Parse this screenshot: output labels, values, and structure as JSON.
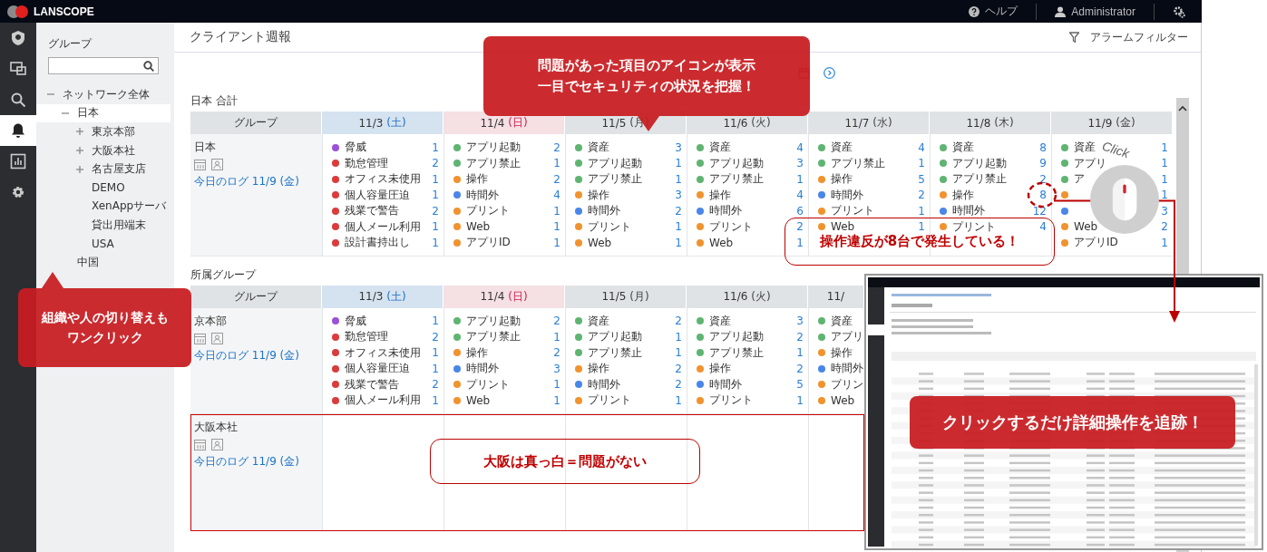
{
  "top_bar": {
    "logo": "LANSCOPE",
    "help": "ヘルプ",
    "user": "Administrator"
  },
  "nav_icons": [
    {
      "kind": "shield",
      "selected": false
    },
    {
      "kind": "monitor",
      "selected": false
    },
    {
      "kind": "search",
      "selected": false
    },
    {
      "kind": "bell",
      "selected": true
    },
    {
      "kind": "chart",
      "selected": false
    },
    {
      "kind": "gear",
      "selected": false
    }
  ],
  "group_panel": {
    "title": "グループ",
    "tree": [
      {
        "label": "ネットワーク全体",
        "expanded": true,
        "selected": false,
        "children": [
          {
            "label": "日本",
            "expanded": true,
            "selected": true,
            "children": [
              {
                "label": "東京本部",
                "expanded": false,
                "selected": false
              },
              {
                "label": "大阪本社",
                "expanded": false,
                "selected": false
              },
              {
                "label": "名古屋支店",
                "expanded": false,
                "selected": false
              },
              {
                "label": "DEMO",
                "selected": false
              },
              {
                "label": "XenAppサーバ",
                "selected": false
              },
              {
                "label": "貸出用端末",
                "selected": false
              },
              {
                "label": "USA",
                "selected": false
              }
            ]
          },
          {
            "label": "中国",
            "selected": false
          }
        ]
      }
    ]
  },
  "page": {
    "title": "クライアント週報",
    "filter": "アラームフィルター"
  },
  "sections": [
    {
      "title": "日本 合計",
      "group_header": "グループ",
      "days": [
        {
          "date": "11/3",
          "weekday": "(土)",
          "kind": "saturday"
        },
        {
          "date": "11/4",
          "weekday": "(日)",
          "kind": "sunday"
        },
        {
          "date": "11/5",
          "weekday": "(月)",
          "kind": "weekday"
        },
        {
          "date": "11/6",
          "weekday": "(火)",
          "kind": "weekday"
        },
        {
          "date": "11/7",
          "weekday": "(水)",
          "kind": "weekday"
        },
        {
          "date": "11/8",
          "weekday": "(木)",
          "kind": "weekday"
        },
        {
          "date": "11/9",
          "weekday": "(金)",
          "kind": "weekday"
        }
      ],
      "rows": [
        {
          "group": "日本",
          "link": "今日のログ 11/9 (金)",
          "highlighted": false,
          "cells": [
            [
              {
                "label": "脅威",
                "count": "1",
                "color": "#9b51d8"
              },
              {
                "label": "勤怠管理",
                "count": "2",
                "color": "#dc3b3b"
              },
              {
                "label": "オフィス未使用",
                "count": "1",
                "color": "#dc3b3b"
              },
              {
                "label": "個人容量圧迫",
                "count": "1",
                "color": "#dc3b3b"
              },
              {
                "label": "残業で警告",
                "count": "2",
                "color": "#dc3b3b"
              },
              {
                "label": "個人メール利用",
                "count": "1",
                "color": "#dc3b3b"
              },
              {
                "label": "設計書持出し",
                "count": "1",
                "color": "#dc3b3b"
              }
            ],
            [
              {
                "label": "アプリ起動",
                "count": "2",
                "color": "#5fb472"
              },
              {
                "label": "アプリ禁止",
                "count": "1",
                "color": "#5fb472"
              },
              {
                "label": "操作",
                "count": "2",
                "color": "#f0932f"
              },
              {
                "label": "時間外",
                "count": "4",
                "color": "#4a86e8"
              },
              {
                "label": "プリント",
                "count": "1",
                "color": "#f0932f"
              },
              {
                "label": "Web",
                "count": "1",
                "color": "#f0932f"
              },
              {
                "label": "アプリID",
                "count": "1",
                "color": "#f0932f"
              }
            ],
            [
              {
                "label": "資産",
                "count": "3",
                "color": "#5fb472"
              },
              {
                "label": "アプリ起動",
                "count": "1",
                "color": "#5fb472"
              },
              {
                "label": "アプリ禁止",
                "count": "1",
                "color": "#5fb472"
              },
              {
                "label": "操作",
                "count": "3",
                "color": "#f0932f"
              },
              {
                "label": "時間外",
                "count": "2",
                "color": "#4a86e8"
              },
              {
                "label": "プリント",
                "count": "1",
                "color": "#f0932f"
              },
              {
                "label": "Web",
                "count": "1",
                "color": "#f0932f"
              }
            ],
            [
              {
                "label": "資産",
                "count": "4",
                "color": "#5fb472"
              },
              {
                "label": "アプリ起動",
                "count": "3",
                "color": "#5fb472"
              },
              {
                "label": "アプリ禁止",
                "count": "1",
                "color": "#5fb472"
              },
              {
                "label": "操作",
                "count": "4",
                "color": "#f0932f"
              },
              {
                "label": "時間外",
                "count": "6",
                "color": "#4a86e8"
              },
              {
                "label": "プリント",
                "count": "2",
                "color": "#f0932f"
              },
              {
                "label": "Web",
                "count": "1",
                "color": "#f0932f"
              }
            ],
            [
              {
                "label": "資産",
                "count": "4",
                "color": "#5fb472"
              },
              {
                "label": "アプリ禁止",
                "count": "1",
                "color": "#5fb472"
              },
              {
                "label": "操作",
                "count": "5",
                "color": "#f0932f"
              },
              {
                "label": "時間外",
                "count": "2",
                "color": "#4a86e8"
              },
              {
                "label": "プリント",
                "count": "1",
                "color": "#f0932f"
              },
              {
                "label": "Web",
                "count": "1",
                "color": "#f0932f"
              }
            ],
            [
              {
                "label": "資産",
                "count": "8",
                "color": "#5fb472"
              },
              {
                "label": "アプリ起動",
                "count": "9",
                "color": "#5fb472"
              },
              {
                "label": "アプリ禁止",
                "count": "2",
                "color": "#5fb472"
              },
              {
                "label": "操作",
                "count": "8",
                "color": "#f0932f"
              },
              {
                "label": "時間外",
                "count": "12",
                "color": "#4a86e8"
              },
              {
                "label": "プリント",
                "count": "4",
                "color": "#f0932f"
              }
            ],
            [
              {
                "label": "資産",
                "count": "1",
                "color": "#5fb472"
              },
              {
                "label": "アプリ",
                "count": "1",
                "color": "#5fb472"
              },
              {
                "label": "ア",
                "count": "1",
                "color": "#5fb472"
              },
              {
                "count": "1",
                "color": "#f0932f"
              },
              {
                "count": "3",
                "color": "#4a86e8"
              },
              {
                "label": "Web",
                "count": "2",
                "color": "#f0932f"
              },
              {
                "label": "アプリID",
                "count": "1",
                "color": "#f0932f"
              }
            ]
          ]
        }
      ]
    },
    {
      "title": "所属グループ",
      "group_header": "グループ",
      "days": [
        {
          "date": "11/3",
          "weekday": "(土)",
          "kind": "saturday"
        },
        {
          "date": "11/4",
          "weekday": "(日)",
          "kind": "sunday"
        },
        {
          "date": "11/5",
          "weekday": "(月)",
          "kind": "weekday"
        },
        {
          "date": "11/6",
          "weekday": "(火)",
          "kind": "weekday"
        },
        {
          "date": "11/",
          "kind": "weekday"
        }
      ],
      "rows": [
        {
          "group": "京本部",
          "link": "今日のログ 11/9 (金)",
          "highlighted": false,
          "cells": [
            [
              {
                "label": "脅威",
                "count": "1",
                "color": "#9b51d8"
              },
              {
                "label": "勤怠管理",
                "count": "2",
                "color": "#dc3b3b"
              },
              {
                "label": "オフィス未使用",
                "count": "1",
                "color": "#dc3b3b"
              },
              {
                "label": "個人容量圧迫",
                "count": "1",
                "color": "#dc3b3b"
              },
              {
                "label": "残業で警告",
                "count": "2",
                "color": "#dc3b3b"
              },
              {
                "label": "個人メール利用",
                "count": "1",
                "color": "#dc3b3b"
              }
            ],
            [
              {
                "label": "アプリ起動",
                "count": "2",
                "color": "#5fb472"
              },
              {
                "label": "アプリ禁止",
                "count": "1",
                "color": "#5fb472"
              },
              {
                "label": "操作",
                "count": "2",
                "color": "#f0932f"
              },
              {
                "label": "時間外",
                "count": "3",
                "color": "#4a86e8"
              },
              {
                "label": "プリント",
                "count": "1",
                "color": "#f0932f"
              },
              {
                "label": "Web",
                "count": "1",
                "color": "#f0932f"
              }
            ],
            [
              {
                "label": "資産",
                "count": "2",
                "color": "#5fb472"
              },
              {
                "label": "アプリ起動",
                "count": "1",
                "color": "#5fb472"
              },
              {
                "label": "アプリ禁止",
                "count": "1",
                "color": "#5fb472"
              },
              {
                "label": "操作",
                "count": "2",
                "color": "#f0932f"
              },
              {
                "label": "時間外",
                "count": "2",
                "color": "#4a86e8"
              },
              {
                "label": "プリント",
                "count": "1",
                "color": "#f0932f"
              }
            ],
            [
              {
                "label": "資産",
                "count": "3",
                "color": "#5fb472"
              },
              {
                "label": "アプリ起動",
                "count": "2",
                "color": "#5fb472"
              },
              {
                "label": "アプリ禁止",
                "count": "1",
                "color": "#5fb472"
              },
              {
                "label": "操作",
                "count": "2",
                "color": "#f0932f"
              },
              {
                "label": "時間外",
                "count": "5",
                "color": "#4a86e8"
              },
              {
                "label": "プリント",
                "count": "1",
                "color": "#f0932f"
              }
            ],
            [
              {
                "label": "資産",
                "color": "#5fb472"
              },
              {
                "label": "アプリ",
                "color": "#5fb472"
              },
              {
                "label": "操作",
                "color": "#f0932f"
              },
              {
                "label": "時間外",
                "color": "#4a86e8"
              },
              {
                "label": "プリン",
                "color": "#f0932f"
              },
              {
                "label": "Web",
                "color": "#f0932f"
              }
            ]
          ]
        },
        {
          "group": "大阪本社",
          "link": "今日のログ 11/9 (金)",
          "highlighted": true,
          "cells": [
            [],
            [],
            [],
            [],
            []
          ]
        }
      ]
    }
  ],
  "annotations": {
    "top_callout": [
      "問題があった項目のアイコンが表示",
      "一目でセキュリティの状況を把握！"
    ],
    "violation_note": "操作違反が8台で発生している！",
    "switch_callout": [
      "組織や人の切り替えも",
      "ワンクリック"
    ],
    "osaka_note": "大阪は真っ白＝問題がない",
    "detail_callout": "クリックするだけ詳細操作を追跡！",
    "click": "Click"
  }
}
